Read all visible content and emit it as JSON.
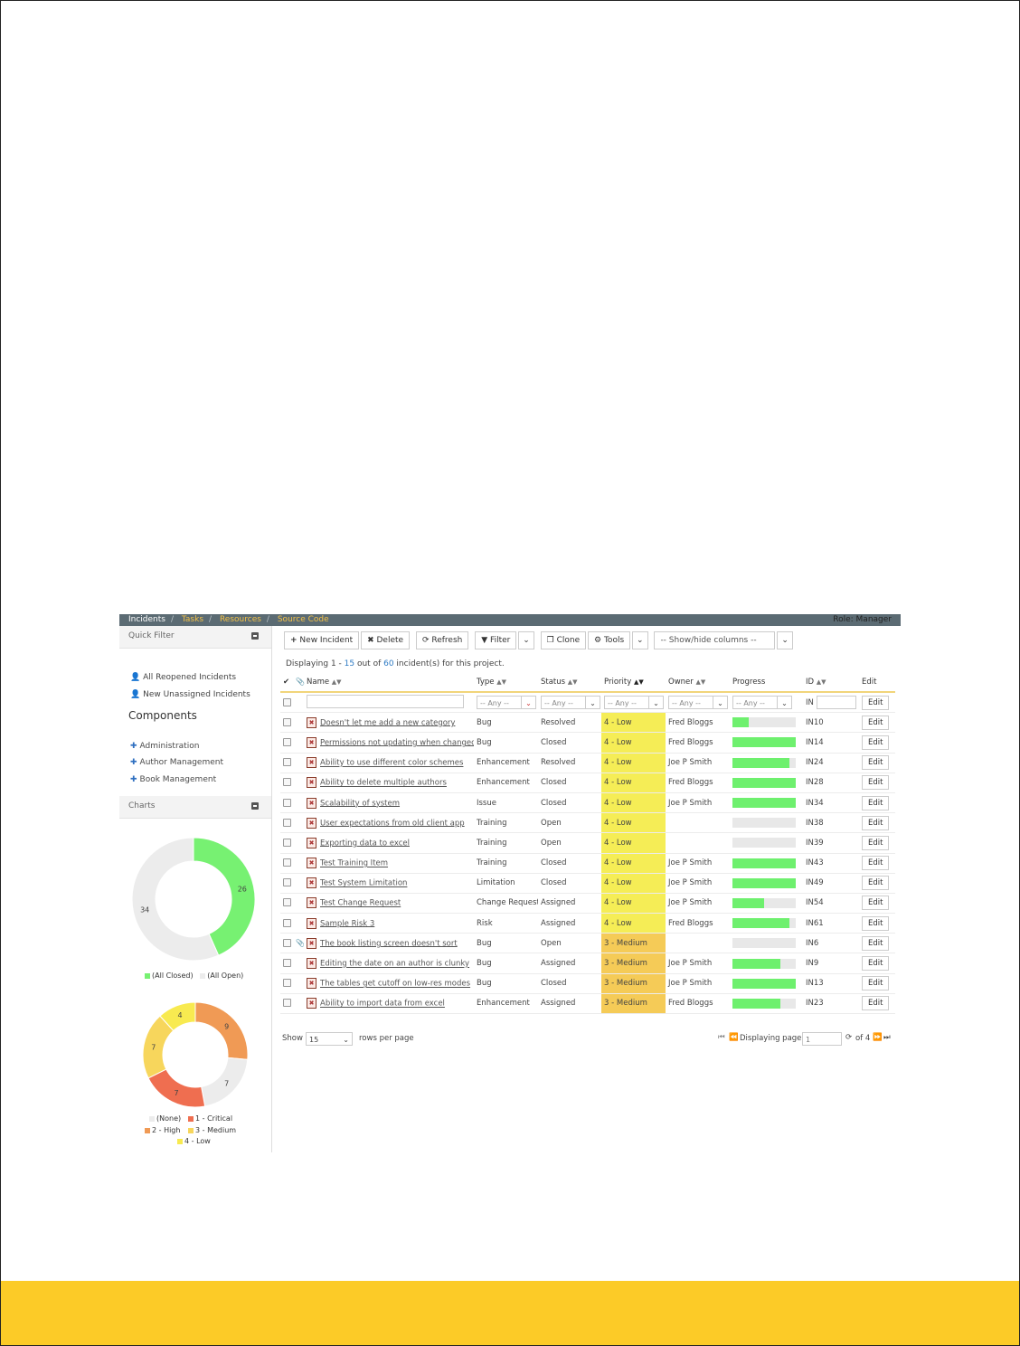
{
  "nav": {
    "tabs": [
      "Incidents",
      "Tasks",
      "Resources",
      "Source Code"
    ],
    "role": "Role: Manager"
  },
  "quick_filter": {
    "title": "Quick Filter",
    "items": [
      "All Reopened Incidents",
      "New Unassigned Incidents"
    ]
  },
  "components": {
    "title": "Components",
    "items": [
      "Administration",
      "Author Management",
      "Book Management"
    ]
  },
  "charts": {
    "title": "Charts",
    "status_chart": {
      "type": "pie",
      "slices": [
        {
          "label": "(All Closed)",
          "value": 26,
          "color": "#77f172"
        },
        {
          "label": "(All Open)",
          "value": 34,
          "color": "#ececec"
        }
      ]
    },
    "priority_chart": {
      "type": "pie",
      "slices": [
        {
          "label": "2 - High",
          "value": 9,
          "color": "#f09a55"
        },
        {
          "label": "(None)",
          "value": 7,
          "color": "#ececec"
        },
        {
          "label": "1 - Critical",
          "value": 7,
          "color": "#ef6e50"
        },
        {
          "label": "3 - Medium",
          "value": 7,
          "color": "#f7d65c"
        },
        {
          "label": "4 - Low",
          "value": 4,
          "color": "#f8ea50"
        }
      ],
      "legend_order": [
        "(None)",
        "1 - Critical",
        "2 - High",
        "3 - Medium",
        "4 - Low"
      ]
    }
  },
  "toolbar": {
    "new_incident": "New Incident",
    "delete": "Delete",
    "refresh": "Refresh",
    "filter": "Filter",
    "clone": "Clone",
    "tools": "Tools",
    "columns": "-- Show/hide columns --"
  },
  "message": {
    "prefix": "Displaying 1 - ",
    "count": "15",
    "middle": " out of ",
    "total": "60",
    "suffix": " incident(s) for this project."
  },
  "columns": {
    "name": "Name",
    "type": "Type",
    "status": "Status",
    "priority": "Priority",
    "owner": "Owner",
    "progress": "Progress",
    "id": "ID",
    "edit": "Edit"
  },
  "filters": {
    "any": "-- Any --",
    "id_prefix": "IN"
  },
  "rows": [
    {
      "name": "Doesn't let me add a new category",
      "type": "Bug",
      "status": "Resolved",
      "priority": "4 - Low",
      "owner": "Fred Bloggs",
      "progress": 0.25,
      "id": "IN10",
      "attachment": false
    },
    {
      "name": "Permissions not updating when changed",
      "type": "Bug",
      "status": "Closed",
      "priority": "4 - Low",
      "owner": "Fred Bloggs",
      "progress": 1.0,
      "id": "IN14",
      "attachment": false
    },
    {
      "name": "Ability to use different color schemes",
      "type": "Enhancement",
      "status": "Resolved",
      "priority": "4 - Low",
      "owner": "Joe P Smith",
      "progress": 0.9,
      "id": "IN24",
      "attachment": false
    },
    {
      "name": "Ability to delete multiple authors",
      "type": "Enhancement",
      "status": "Closed",
      "priority": "4 - Low",
      "owner": "Fred Bloggs",
      "progress": 1.0,
      "id": "IN28",
      "attachment": false
    },
    {
      "name": "Scalability of system",
      "type": "Issue",
      "status": "Closed",
      "priority": "4 - Low",
      "owner": "Joe P Smith",
      "progress": 1.0,
      "id": "IN34",
      "attachment": false
    },
    {
      "name": "User expectations from old client app",
      "type": "Training",
      "status": "Open",
      "priority": "4 - Low",
      "owner": "",
      "progress": 0.0,
      "id": "IN38",
      "attachment": false
    },
    {
      "name": "Exporting data to excel",
      "type": "Training",
      "status": "Open",
      "priority": "4 - Low",
      "owner": "",
      "progress": 0.0,
      "id": "IN39",
      "attachment": false
    },
    {
      "name": "Test Training Item",
      "type": "Training",
      "status": "Closed",
      "priority": "4 - Low",
      "owner": "Joe P Smith",
      "progress": 1.0,
      "id": "IN43",
      "attachment": false
    },
    {
      "name": "Test System Limitation",
      "type": "Limitation",
      "status": "Closed",
      "priority": "4 - Low",
      "owner": "Joe P Smith",
      "progress": 1.0,
      "id": "IN49",
      "attachment": false
    },
    {
      "name": "Test Change Request",
      "type": "Change Request",
      "status": "Assigned",
      "priority": "4 - Low",
      "owner": "Joe P Smith",
      "progress": 0.5,
      "id": "IN54",
      "attachment": false
    },
    {
      "name": "Sample Risk 3",
      "type": "Risk",
      "status": "Assigned",
      "priority": "4 - Low",
      "owner": "Fred Bloggs",
      "progress": 0.9,
      "id": "IN61",
      "attachment": false
    },
    {
      "name": "The book listing screen doesn't sort",
      "type": "Bug",
      "status": "Open",
      "priority": "3 - Medium",
      "owner": "",
      "progress": 0.0,
      "id": "IN6",
      "attachment": true
    },
    {
      "name": "Editing the date on an author is clunky",
      "type": "Bug",
      "status": "Assigned",
      "priority": "3 - Medium",
      "owner": "Joe P Smith",
      "progress": 0.75,
      "id": "IN9",
      "attachment": false
    },
    {
      "name": "The tables get cutoff on low-res modes",
      "type": "Bug",
      "status": "Closed",
      "priority": "3 - Medium",
      "owner": "Joe P Smith",
      "progress": 1.0,
      "id": "IN13",
      "attachment": false
    },
    {
      "name": "Ability to import data from excel",
      "type": "Enhancement",
      "status": "Assigned",
      "priority": "3 - Medium",
      "owner": "Fred Bloggs",
      "progress": 0.75,
      "id": "IN23",
      "attachment": false
    }
  ],
  "edit_label": "Edit",
  "pager": {
    "show": "Show",
    "rows_value": "15",
    "rows_per_page": "rows per page",
    "displaying_page": "Displaying page",
    "page_value": "1",
    "of": "of 4"
  },
  "colors": {
    "footer": "#fccb27",
    "topbar": "#5b6b73",
    "priority_low": "#f5ed56",
    "priority_medium": "#f5cb57",
    "progress": "#6ef06e"
  }
}
